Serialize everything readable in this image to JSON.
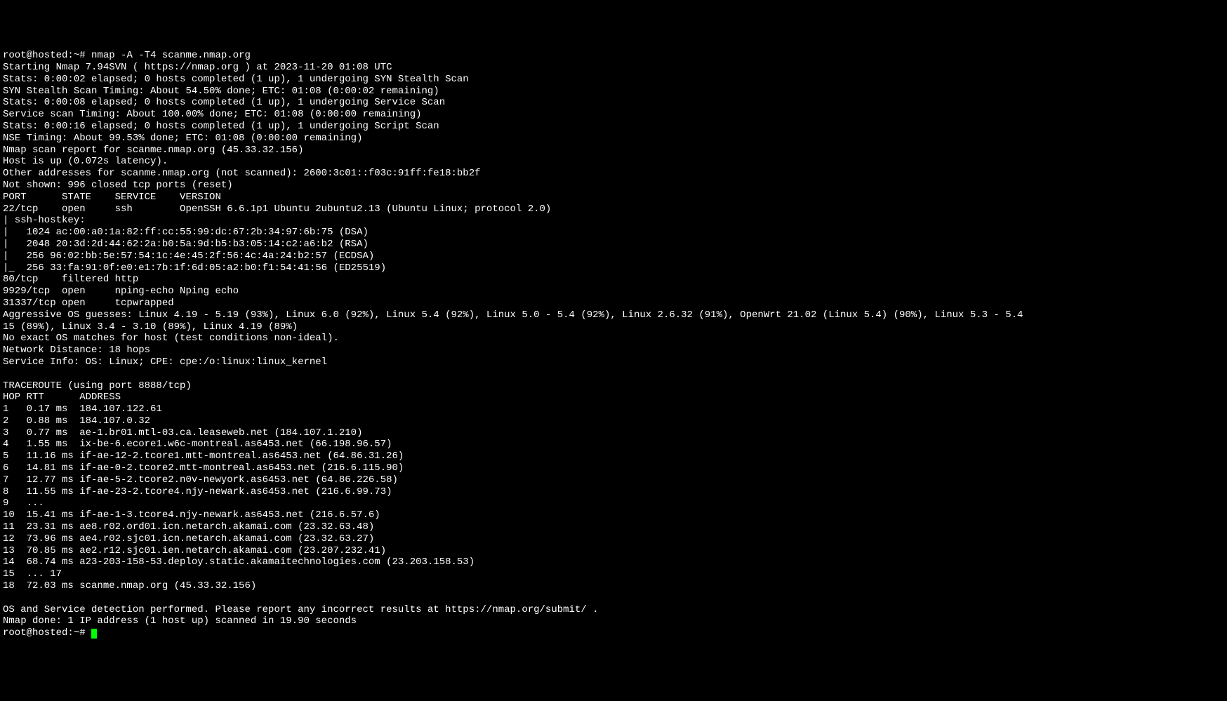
{
  "prompt1": "root@hosted:~# ",
  "command": "nmap -A -T4 scanme.nmap.org",
  "lines": [
    "Starting Nmap 7.94SVN ( https://nmap.org ) at 2023-11-20 01:08 UTC",
    "Stats: 0:00:02 elapsed; 0 hosts completed (1 up), 1 undergoing SYN Stealth Scan",
    "SYN Stealth Scan Timing: About 54.50% done; ETC: 01:08 (0:00:02 remaining)",
    "Stats: 0:00:08 elapsed; 0 hosts completed (1 up), 1 undergoing Service Scan",
    "Service scan Timing: About 100.00% done; ETC: 01:08 (0:00:00 remaining)",
    "Stats: 0:00:16 elapsed; 0 hosts completed (1 up), 1 undergoing Script Scan",
    "NSE Timing: About 99.53% done; ETC: 01:08 (0:00:00 remaining)",
    "Nmap scan report for scanme.nmap.org (45.33.32.156)",
    "Host is up (0.072s latency).",
    "Other addresses for scanme.nmap.org (not scanned): 2600:3c01::f03c:91ff:fe18:bb2f",
    "Not shown: 996 closed tcp ports (reset)",
    "PORT      STATE    SERVICE    VERSION",
    "22/tcp    open     ssh        OpenSSH 6.6.1p1 Ubuntu 2ubuntu2.13 (Ubuntu Linux; protocol 2.0)",
    "| ssh-hostkey: ",
    "|   1024 ac:00:a0:1a:82:ff:cc:55:99:dc:67:2b:34:97:6b:75 (DSA)",
    "|   2048 20:3d:2d:44:62:2a:b0:5a:9d:b5:b3:05:14:c2:a6:b2 (RSA)",
    "|   256 96:02:bb:5e:57:54:1c:4e:45:2f:56:4c:4a:24:b2:57 (ECDSA)",
    "|_  256 33:fa:91:0f:e0:e1:7b:1f:6d:05:a2:b0:f1:54:41:56 (ED25519)",
    "80/tcp    filtered http",
    "9929/tcp  open     nping-echo Nping echo",
    "31337/tcp open     tcpwrapped",
    "Aggressive OS guesses: Linux 4.19 - 5.19 (93%), Linux 6.0 (92%), Linux 5.4 (92%), Linux 5.0 - 5.4 (92%), Linux 2.6.32 (91%), OpenWrt 21.02 (Linux 5.4) (90%), Linux 5.3 - 5.4",
    "15 (89%), Linux 3.4 - 3.10 (89%), Linux 4.19 (89%)",
    "No exact OS matches for host (test conditions non-ideal).",
    "Network Distance: 18 hops",
    "Service Info: OS: Linux; CPE: cpe:/o:linux:linux_kernel",
    "",
    "TRACEROUTE (using port 8888/tcp)",
    "HOP RTT      ADDRESS",
    "1   0.17 ms  184.107.122.61",
    "2   0.88 ms  184.107.0.32",
    "3   0.77 ms  ae-1.br01.mtl-03.ca.leaseweb.net (184.107.1.210)",
    "4   1.55 ms  ix-be-6.ecore1.w6c-montreal.as6453.net (66.198.96.57)",
    "5   11.16 ms if-ae-12-2.tcore1.mtt-montreal.as6453.net (64.86.31.26)",
    "6   14.81 ms if-ae-0-2.tcore2.mtt-montreal.as6453.net (216.6.115.90)",
    "7   12.77 ms if-ae-5-2.tcore2.n0v-newyork.as6453.net (64.86.226.58)",
    "8   11.55 ms if-ae-23-2.tcore4.njy-newark.as6453.net (216.6.99.73)",
    "9   ...",
    "10  15.41 ms if-ae-1-3.tcore4.njy-newark.as6453.net (216.6.57.6)",
    "11  23.31 ms ae8.r02.ord01.icn.netarch.akamai.com (23.32.63.48)",
    "12  73.96 ms ae4.r02.sjc01.icn.netarch.akamai.com (23.32.63.27)",
    "13  70.85 ms ae2.r12.sjc01.ien.netarch.akamai.com (23.207.232.41)",
    "14  68.74 ms a23-203-158-53.deploy.static.akamaitechnologies.com (23.203.158.53)",
    "15  ... 17",
    "18  72.03 ms scanme.nmap.org (45.33.32.156)",
    "",
    "OS and Service detection performed. Please report any incorrect results at https://nmap.org/submit/ .",
    "Nmap done: 1 IP address (1 host up) scanned in 19.90 seconds"
  ],
  "prompt2": "root@hosted:~# "
}
